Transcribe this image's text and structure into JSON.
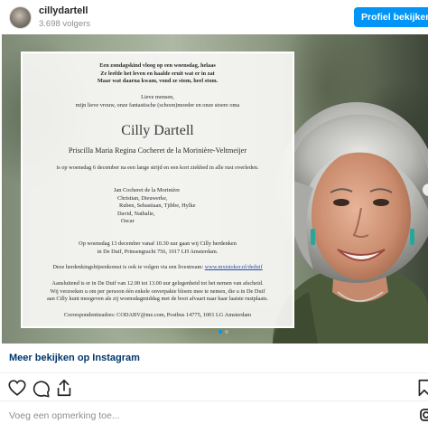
{
  "header": {
    "username": "cillydartell",
    "followers": "3.698 volgers",
    "profile_button": "Profiel bekijken"
  },
  "card": {
    "poem": [
      "Een zondagskind vloog op een woensdag, helaas",
      "Ze leefde het leven en haalde eruit wat er in zat",
      "Maar wat daarna kwam, vond ze stom, heel stom."
    ],
    "intro": [
      "Lieve mensen,",
      "mijn lieve vrouw, onze fantastische (schoon)moeder en onze stoere oma"
    ],
    "name": "Cilly Dartell",
    "full_name": "Priscilla Maria Regina Cocheret de la Morinière-Veltmeijer",
    "death_notice": "is op woensdag 6 december na een lange strijd en een kort ziekbed in alle rust overleden.",
    "family": [
      "Jan Cocheret de la Morinière",
      "Christian, Dieuwerke,",
      "Ruben, Sebastiaan, Tjibbe, Hylke",
      "David, Nathalie,",
      "Oscar"
    ],
    "ceremony": [
      "Op woensdag 13 december vanaf 10.30 uur gaan wij Cilly herdenken",
      "in De Duif, Prinsengracht 756, 1017 LH Amsterdam."
    ],
    "livestream_text": "Deze herdenkingsbijeenkomst is ook te volgen via een livestream:",
    "livestream_link": "www.mxtstoker.nl/deduif",
    "farewell": [
      "Aansluitend is er in De Duif van 12.00 tot 13.00 uur gelegenheid tot het nemen van afscheid.",
      "Wij verzoeken u om per persoon één enkele onverpakte bloem mee te nemen, die u in De Duif",
      "aan Cilly kunt meegeven als zij woensdagmiddag met de boot afvaart naar haar laatste rustplaats."
    ],
    "correspondence": "Correspondentieadres: CODABV@me.com, Postbus 14775, 1001 LG  Amsterdam"
  },
  "carousel": {
    "count": 2,
    "active_index": 0
  },
  "more_link": "Meer bekijken op Instagram",
  "icons": {
    "avatar": "profile-photo",
    "like": "heart-icon",
    "comment": "comment-bubble-icon",
    "share": "share-icon",
    "save": "bookmark-icon",
    "instagram": "instagram-logo-icon",
    "next": "chevron-right-icon"
  },
  "comment": {
    "placeholder": "Voeg een opmerking toe..."
  },
  "colors": {
    "button_blue": "#0095f6",
    "link_dark_blue": "#00376b",
    "text": "#262626",
    "muted": "#8e8e8e",
    "carousel_dot_active": "#0095f6",
    "carousel_dot_inactive": "#a8a8a8"
  }
}
